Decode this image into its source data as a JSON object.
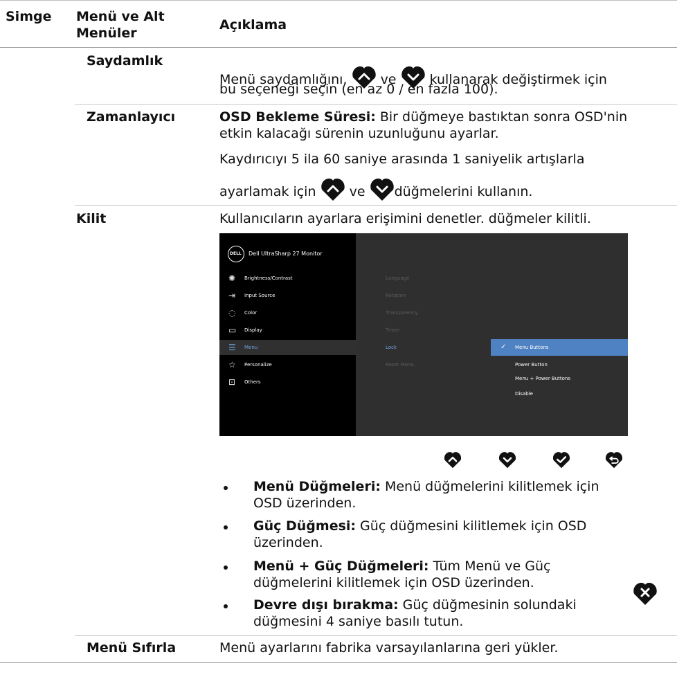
{
  "header": {
    "col1": "Simge",
    "col2_line1": "Menü ve Alt",
    "col2_line2": "Menüler",
    "col3": "Açıklama"
  },
  "rows": {
    "saydamlik": {
      "label": "Saydamlık",
      "text_a": "Menü saydamlığını,",
      "text_ve": "ve",
      "text_b": "kullanarak değiştirmek için",
      "text_line2": "bu seçeneği seçin (en az 0 / en fazla 100)."
    },
    "zamanlayici": {
      "label": "Zamanlayıcı",
      "bold": "OSD Bekleme Süresi:",
      "line1_rest": " Bir düğmeye bastıktan sonra OSD'nin",
      "line2": "etkin kalacağı sürenin uzunluğunu ayarlar.",
      "line3": "Kaydırıcıyı 5 ila 60 saniye arasında 1 saniyelik artışlarla",
      "line4_a": "ayarlamak için",
      "line4_ve": "ve",
      "line4_b": "düğmelerini kullanın."
    },
    "kilit": {
      "label": "Kilit",
      "desc": "Kullanıcıların ayarlara erişimini denetler. düğmeler kilitli.",
      "bullets": [
        {
          "bold": "Menü Düğmeleri:",
          "rest": " Menü düğmelerini kilitlemek için",
          "line2": "OSD üzerinden."
        },
        {
          "bold": "Güç Düğmesi:",
          "rest": " Güç düğmesini kilitlemek için OSD",
          "line2": "üzerinden."
        },
        {
          "bold": "Menü + Güç Düğmeleri:",
          "rest": " Tüm Menü ve Güç",
          "line2": "düğmelerini kilitlemek için OSD üzerinden."
        },
        {
          "bold": "Devre dışı bırakma:",
          "rest": " Güç düğmesinin solundaki",
          "line2": "düğmesini 4 saniye basılı tutun."
        }
      ]
    },
    "sifirla": {
      "label": "Menü Sıfırla",
      "desc": "Menü ayarlarını fabrika varsayılanlarına geri yükler."
    }
  },
  "osd": {
    "logo": "DELL",
    "title": "Dell UltraSharp 27 Monitor",
    "menu": [
      {
        "label": "Brightness/Contrast",
        "icon": "sun-icon"
      },
      {
        "label": "Input Source",
        "icon": "input-icon"
      },
      {
        "label": "Color",
        "icon": "palette-icon"
      },
      {
        "label": "Display",
        "icon": "monitor-icon"
      },
      {
        "label": "Menu",
        "icon": "menu-list-icon"
      },
      {
        "label": "Personalize",
        "icon": "star-icon"
      },
      {
        "label": "Others",
        "icon": "others-icon"
      }
    ],
    "submenu": [
      "Language",
      "Rotation",
      "Transparency",
      "Timer",
      "Lock",
      "Reset Menu"
    ],
    "options": [
      "Menu Buttons",
      "Power Button",
      "Menu + Power Buttons",
      "Disable"
    ],
    "selected_option": "Menu Buttons",
    "colors": {
      "highlight": "#4f82c2",
      "active_text": "#6fa3e0",
      "panel": "#2f2f2f",
      "left": "#000000"
    }
  },
  "icons": [
    "up-arrow-icon",
    "down-arrow-icon",
    "check-icon",
    "back-icon",
    "close-icon"
  ]
}
